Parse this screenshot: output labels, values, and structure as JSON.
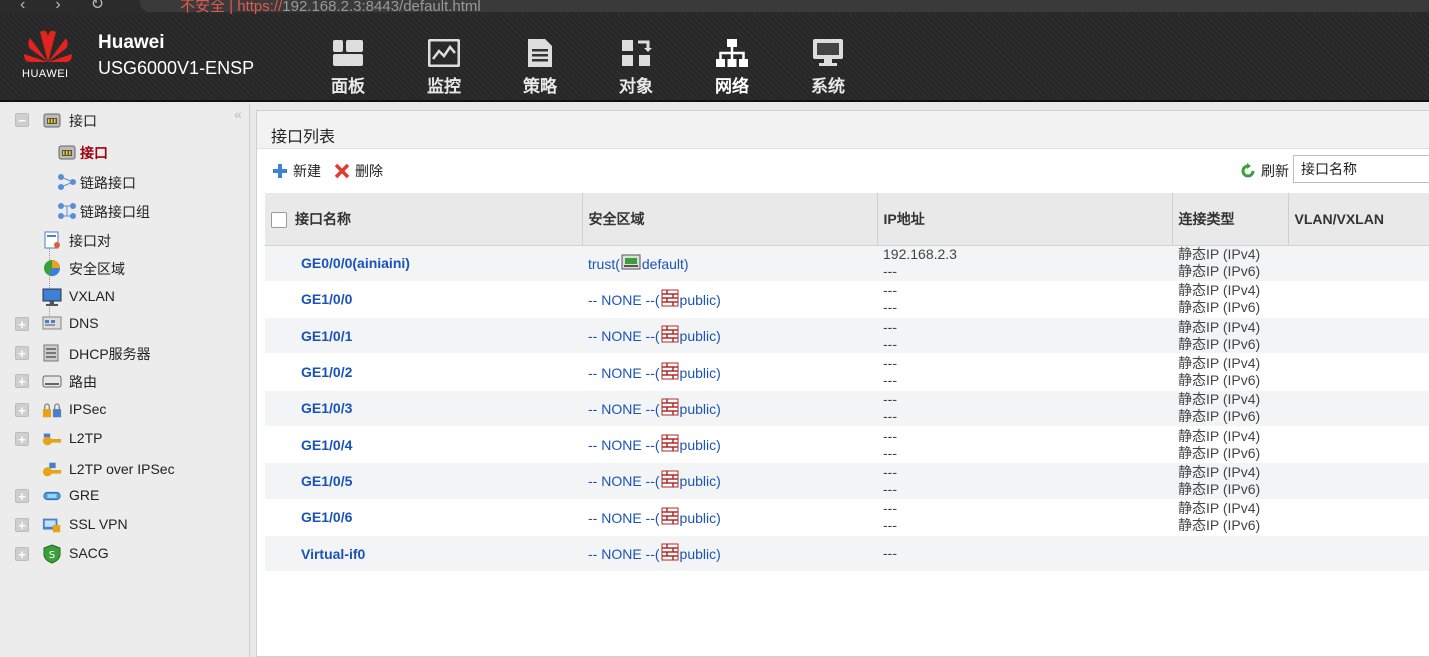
{
  "browser": {
    "url_prefix": "不安全 | https://",
    "url_path": "192.168.2.3:8443/default.html"
  },
  "header": {
    "logo_text": "HUAWEI",
    "brand_line1": "Huawei",
    "brand_line2": "USG6000V1-ENSP",
    "menu": [
      {
        "label": "面板",
        "icon": "dashboard-icon"
      },
      {
        "label": "监控",
        "icon": "monitor-icon"
      },
      {
        "label": "策略",
        "icon": "policy-icon"
      },
      {
        "label": "对象",
        "icon": "object-icon"
      },
      {
        "label": "网络",
        "icon": "network-icon",
        "active": true
      },
      {
        "label": "系统",
        "icon": "system-icon"
      }
    ]
  },
  "sidebar": {
    "items": [
      {
        "label": "接口"
      },
      {
        "label": "接口"
      },
      {
        "label": "链路接口"
      },
      {
        "label": "链路接口组"
      },
      {
        "label": "接口对"
      },
      {
        "label": "安全区域"
      },
      {
        "label": "VXLAN"
      },
      {
        "label": "DNS"
      },
      {
        "label": "DHCP服务器"
      },
      {
        "label": "路由"
      },
      {
        "label": "IPSec"
      },
      {
        "label": "L2TP"
      },
      {
        "label": "L2TP over IPSec"
      },
      {
        "label": "GRE"
      },
      {
        "label": "SSL VPN"
      },
      {
        "label": "SACG"
      }
    ]
  },
  "panel": {
    "title": "接口列表",
    "new_label": "新建",
    "delete_label": "删除",
    "refresh_label": "刷新",
    "search_value": "接口名称"
  },
  "table": {
    "headers": [
      "接口名称",
      "安全区域",
      "IP地址",
      "连接类型",
      "VLAN/VXLAN"
    ],
    "rows": [
      {
        "name": "GE0/0/0(ainiaini)",
        "zone_prefix": "trust(",
        "zone_suffix": "default)",
        "ip1": "192.168.2.3",
        "ip2": "---",
        "type1": "静态IP (IPv4)",
        "type2": "静态IP (IPv6)"
      },
      {
        "name": "GE1/0/0",
        "zone_prefix": "-- NONE --(",
        "zone_suffix": "public)",
        "ip1": "---",
        "ip2": "---",
        "type1": "静态IP (IPv4)",
        "type2": "静态IP (IPv6)"
      },
      {
        "name": "GE1/0/1",
        "zone_prefix": "-- NONE --(",
        "zone_suffix": "public)",
        "ip1": "---",
        "ip2": "---",
        "type1": "静态IP (IPv4)",
        "type2": "静态IP (IPv6)"
      },
      {
        "name": "GE1/0/2",
        "zone_prefix": "-- NONE --(",
        "zone_suffix": "public)",
        "ip1": "---",
        "ip2": "---",
        "type1": "静态IP (IPv4)",
        "type2": "静态IP (IPv6)"
      },
      {
        "name": "GE1/0/3",
        "zone_prefix": "-- NONE --(",
        "zone_suffix": "public)",
        "ip1": "---",
        "ip2": "---",
        "type1": "静态IP (IPv4)",
        "type2": "静态IP (IPv6)"
      },
      {
        "name": "GE1/0/4",
        "zone_prefix": "-- NONE --(",
        "zone_suffix": "public)",
        "ip1": "---",
        "ip2": "---",
        "type1": "静态IP (IPv4)",
        "type2": "静态IP (IPv6)"
      },
      {
        "name": "GE1/0/5",
        "zone_prefix": "-- NONE --(",
        "zone_suffix": "public)",
        "ip1": "---",
        "ip2": "---",
        "type1": "静态IP (IPv4)",
        "type2": "静态IP (IPv6)"
      },
      {
        "name": "GE1/0/6",
        "zone_prefix": "-- NONE --(",
        "zone_suffix": "public)",
        "ip1": "---",
        "ip2": "---",
        "type1": "静态IP (IPv4)",
        "type2": "静态IP (IPv6)"
      },
      {
        "name": "Virtual-if0",
        "zone_prefix": "-- NONE --(",
        "zone_suffix": "public)",
        "ip1": "---",
        "ip2": "",
        "type1": "",
        "type2": ""
      }
    ]
  },
  "colors": {
    "link": "#1a53b8",
    "selected": "#a1000d",
    "brand_red": "#e3231c"
  }
}
